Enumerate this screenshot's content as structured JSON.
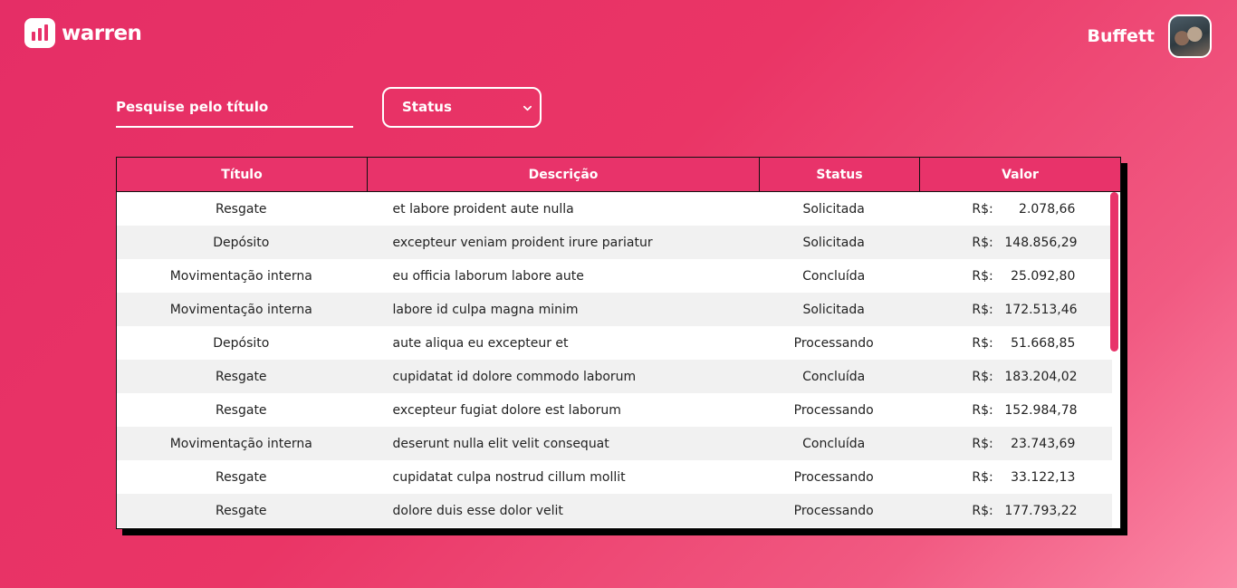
{
  "brand": {
    "name": "warren"
  },
  "user": {
    "name": "Buffett"
  },
  "filters": {
    "search_placeholder": "Pesquise pelo título",
    "status_label": "Status"
  },
  "table": {
    "headers": [
      "Título",
      "Descrição",
      "Status",
      "Valor"
    ],
    "rows": [
      {
        "titulo": "Resgate",
        "descricao": "et labore proident aute nulla",
        "status": "Solicitada",
        "moeda": "R$:",
        "valor": "2.078,66"
      },
      {
        "titulo": "Depósito",
        "descricao": "excepteur veniam proident irure pariatur",
        "status": "Solicitada",
        "moeda": "R$:",
        "valor": "148.856,29"
      },
      {
        "titulo": "Movimentação interna",
        "descricao": "eu officia laborum labore aute",
        "status": "Concluída",
        "moeda": "R$:",
        "valor": "25.092,80"
      },
      {
        "titulo": "Movimentação interna",
        "descricao": "labore id culpa magna minim",
        "status": "Solicitada",
        "moeda": "R$:",
        "valor": "172.513,46"
      },
      {
        "titulo": "Depósito",
        "descricao": "aute aliqua eu excepteur et",
        "status": "Processando",
        "moeda": "R$:",
        "valor": "51.668,85"
      },
      {
        "titulo": "Resgate",
        "descricao": "cupidatat id dolore commodo laborum",
        "status": "Concluída",
        "moeda": "R$:",
        "valor": "183.204,02"
      },
      {
        "titulo": "Resgate",
        "descricao": "excepteur fugiat dolore est laborum",
        "status": "Processando",
        "moeda": "R$:",
        "valor": "152.984,78"
      },
      {
        "titulo": "Movimentação interna",
        "descricao": "deserunt nulla elit velit consequat",
        "status": "Concluída",
        "moeda": "R$:",
        "valor": "23.743,69"
      },
      {
        "titulo": "Resgate",
        "descricao": "cupidatat culpa nostrud cillum mollit",
        "status": "Processando",
        "moeda": "R$:",
        "valor": "33.122,13"
      },
      {
        "titulo": "Resgate",
        "descricao": "dolore duis esse dolor velit",
        "status": "Processando",
        "moeda": "R$:",
        "valor": "177.793,22"
      }
    ]
  },
  "colors": {
    "accent": "#e8336a",
    "background_start": "#e52e66",
    "background_end": "#fb88a6"
  },
  "icons": {
    "logo": "bar-chart-icon",
    "status_dropdown": "chevron-down-icon"
  }
}
